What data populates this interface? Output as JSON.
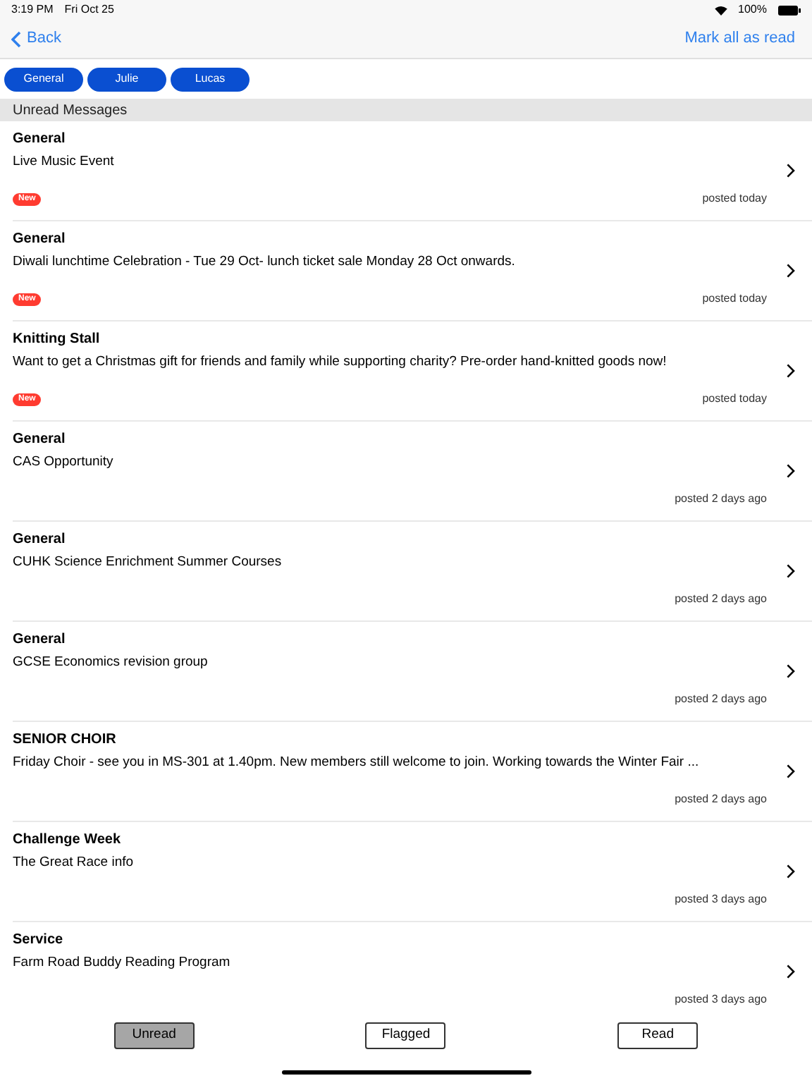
{
  "status_bar": {
    "time": "3:19 PM",
    "date": "Fri Oct 25",
    "battery": "100%"
  },
  "nav": {
    "back": "Back",
    "action": "Mark all as read"
  },
  "filters": [
    "General",
    "Julie",
    "Lucas"
  ],
  "section": "Unread Messages",
  "messages": [
    {
      "category": "General",
      "text": "Live Music Event",
      "badge": "New",
      "posted": "posted today"
    },
    {
      "category": "General",
      "text": "Diwali lunchtime Celebration - Tue 29 Oct- lunch ticket sale Monday 28 Oct onwards.",
      "badge": "New",
      "posted": "posted today"
    },
    {
      "category": "Knitting Stall",
      "text": "Want to get a Christmas gift for friends and family while supporting charity? Pre-order hand-knitted goods now!",
      "badge": "New",
      "posted": "posted today"
    },
    {
      "category": "General",
      "text": "CAS Opportunity",
      "posted": "posted 2 days ago"
    },
    {
      "category": "General",
      "text": "CUHK Science Enrichment Summer Courses",
      "posted": "posted 2 days ago"
    },
    {
      "category": "General",
      "text": "GCSE Economics revision group",
      "posted": "posted 2 days ago"
    },
    {
      "category": "SENIOR CHOIR",
      "text": "Friday Choir - see you in MS-301 at 1.40pm. New members still welcome to join. Working towards the Winter Fair ...",
      "posted": "posted 2 days ago"
    },
    {
      "category": "Challenge Week",
      "text": "The Great Race info",
      "posted": "posted 3 days ago"
    },
    {
      "category": "Service",
      "text": "Farm Road Buddy Reading Program",
      "posted": "posted 3 days ago"
    }
  ],
  "tabs": [
    {
      "label": "Unread",
      "selected": true
    },
    {
      "label": "Flagged",
      "selected": false
    },
    {
      "label": "Read",
      "selected": false
    }
  ]
}
